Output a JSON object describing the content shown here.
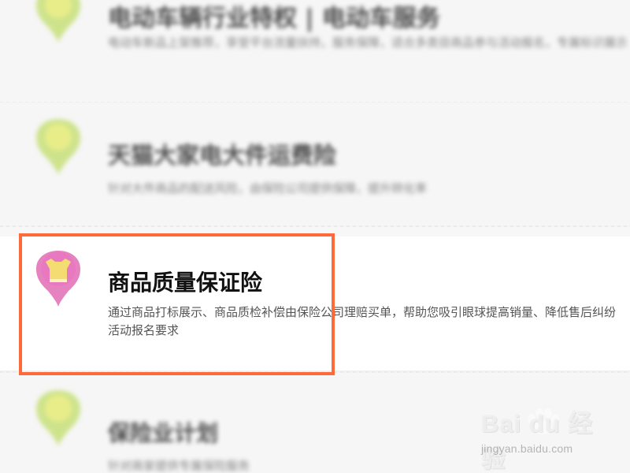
{
  "items": [
    {
      "title": "电动车辆行业特权 | 电动车服务",
      "desc": "电动车新品上架推荐，享受平台流量扶持，服务保障，适合多类目商品参与活动报名，专属标识展示"
    },
    {
      "title": "天猫大家电大件运费险",
      "desc": "针对大件商品的配送风险，由保险公司提供保障，提升转化率"
    },
    {
      "title": "商品质量保证险",
      "desc_line_1": "通过商品打标展示、商品质检补偿由保险公司理赔买单，帮助您吸引眼球提高销量、降低售后纠纷",
      "desc_line_2": "活动报名要求"
    },
    {
      "title": "保险业计划",
      "desc": "针对商家提供专属保险服务"
    }
  ],
  "icons": {
    "pin_green": "green-location-pin",
    "pin_pink_shirt": "pink-shirt-location-pin"
  },
  "colors": {
    "highlight": "#ff6a3d",
    "pin_green_outer": "#c5df74",
    "pin_green_inner": "#e6ec73",
    "pin_pink": "#e582bf",
    "shirt_yellow": "#f4dc73"
  },
  "watermark": {
    "brand": "Bai du 经验",
    "url": "jingyan.baidu.com"
  }
}
